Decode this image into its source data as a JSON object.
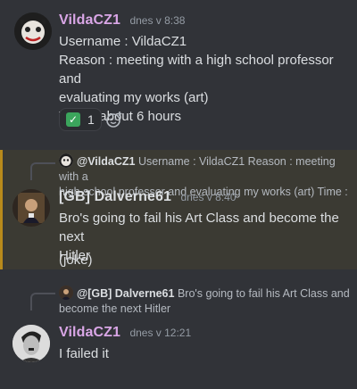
{
  "messages": [
    {
      "author": "VildaCZ1",
      "author_color": "#d9a6e6",
      "timestamp": "dnes v 8:38",
      "lines": [
        "Username : VildaCZ1",
        "Reason : meeting with a high school professor and",
        "evaluating my works (art)",
        "Time : about 6 hours"
      ],
      "reactions": [
        {
          "emoji": "check-mark-icon",
          "count": "1"
        }
      ]
    },
    {
      "reply_to": {
        "author": "@VildaCZ1",
        "preview_line1": "Username : VildaCZ1 Reason : meeting with a",
        "preview_line2": "high school professor and evaluating my works (art) Time :"
      },
      "author": "[GB] Dalverne61",
      "author_color": "#dbdee1",
      "timestamp": "dnes v 8:40",
      "lines": [
        "Bro's going to fail his Art Class and become the next",
        "Hitler"
      ],
      "extra_line": "(joke)",
      "highlight_color": "#b88a1b"
    },
    {
      "reply_to": {
        "author": "@[GB] Dalverne61",
        "preview_line1": "Bro's going to fail his Art Class and",
        "preview_line2": "become the next Hitler"
      },
      "author": "VildaCZ1",
      "author_color": "#d9a6e6",
      "timestamp": "dnes v 12:21",
      "lines": [
        "I failed it"
      ]
    }
  ]
}
